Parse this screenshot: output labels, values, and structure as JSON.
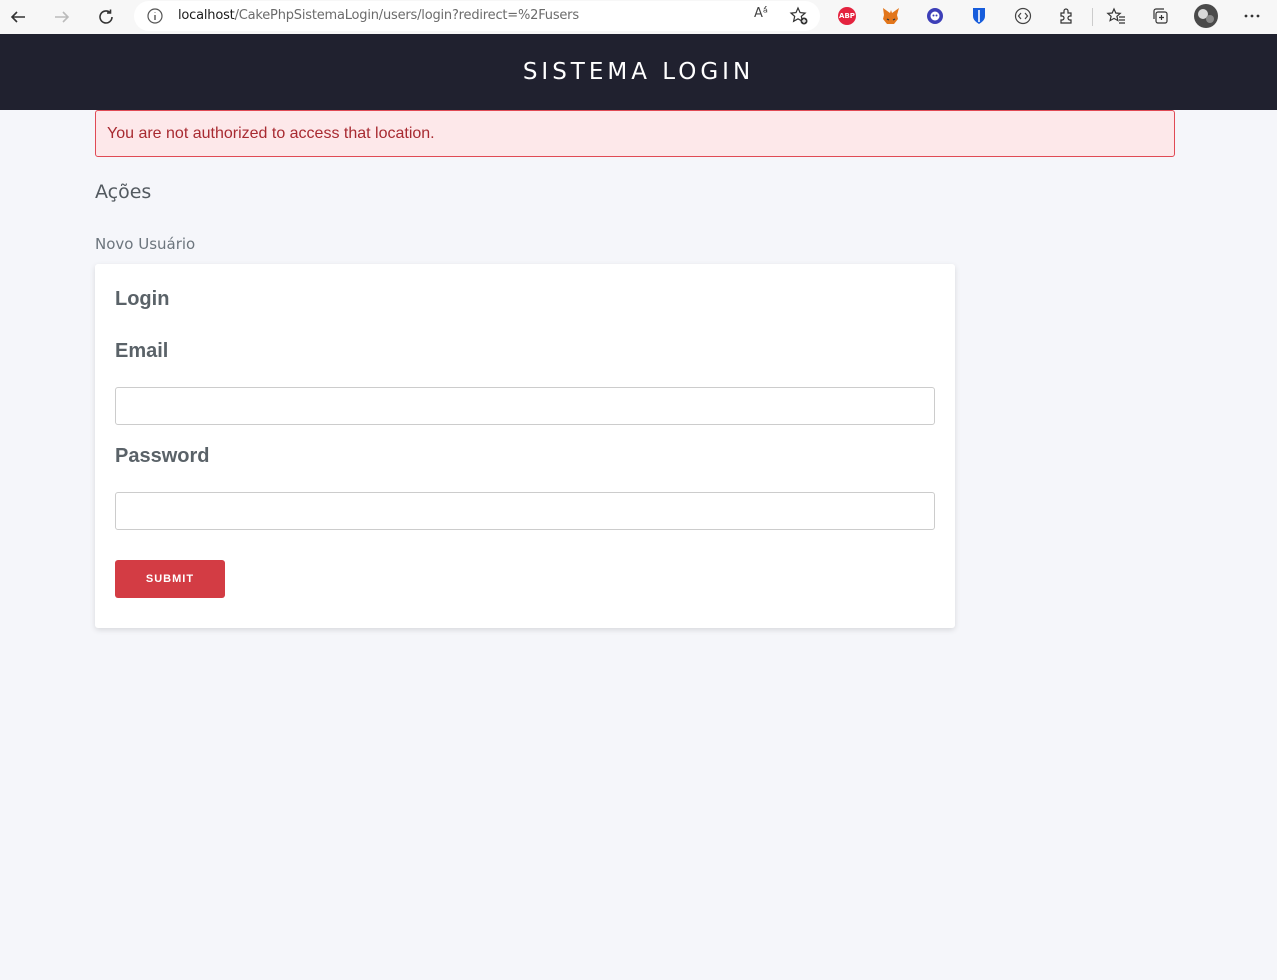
{
  "browser": {
    "url_host": "localhost",
    "url_path": "/CakePhpSistemaLogin/users/login?redirect=%2Fusers",
    "read_aloud_label": "Aᵃ́",
    "abp_label": "ABP",
    "icons": [
      "back-icon",
      "forward-icon",
      "refresh-icon",
      "info-icon",
      "read-aloud-icon",
      "add-favorite-icon",
      "adblock-plus-icon",
      "metamask-icon",
      "extension-icon",
      "bitwarden-icon",
      "devtools-icon",
      "extensions-icon",
      "favorites-icon",
      "collections-icon",
      "profile-avatar-icon",
      "more-icon"
    ]
  },
  "header": {
    "title": "SISTEMA LOGIN"
  },
  "flash": {
    "message": "You are not authorized to access that location."
  },
  "actions": {
    "heading": "Ações",
    "new_user_link": "Novo Usuário"
  },
  "form": {
    "legend": "Login",
    "email_label": "Email",
    "email_value": "",
    "password_label": "Password",
    "password_value": "",
    "submit_label": "SUBMIT"
  },
  "colors": {
    "header_bg": "#20212f",
    "flash_bg": "#fde8ea",
    "flash_border": "#e04a55",
    "flash_text": "#a82a31",
    "submit_bg": "#d33c44",
    "page_bg": "#f5f6fa"
  }
}
